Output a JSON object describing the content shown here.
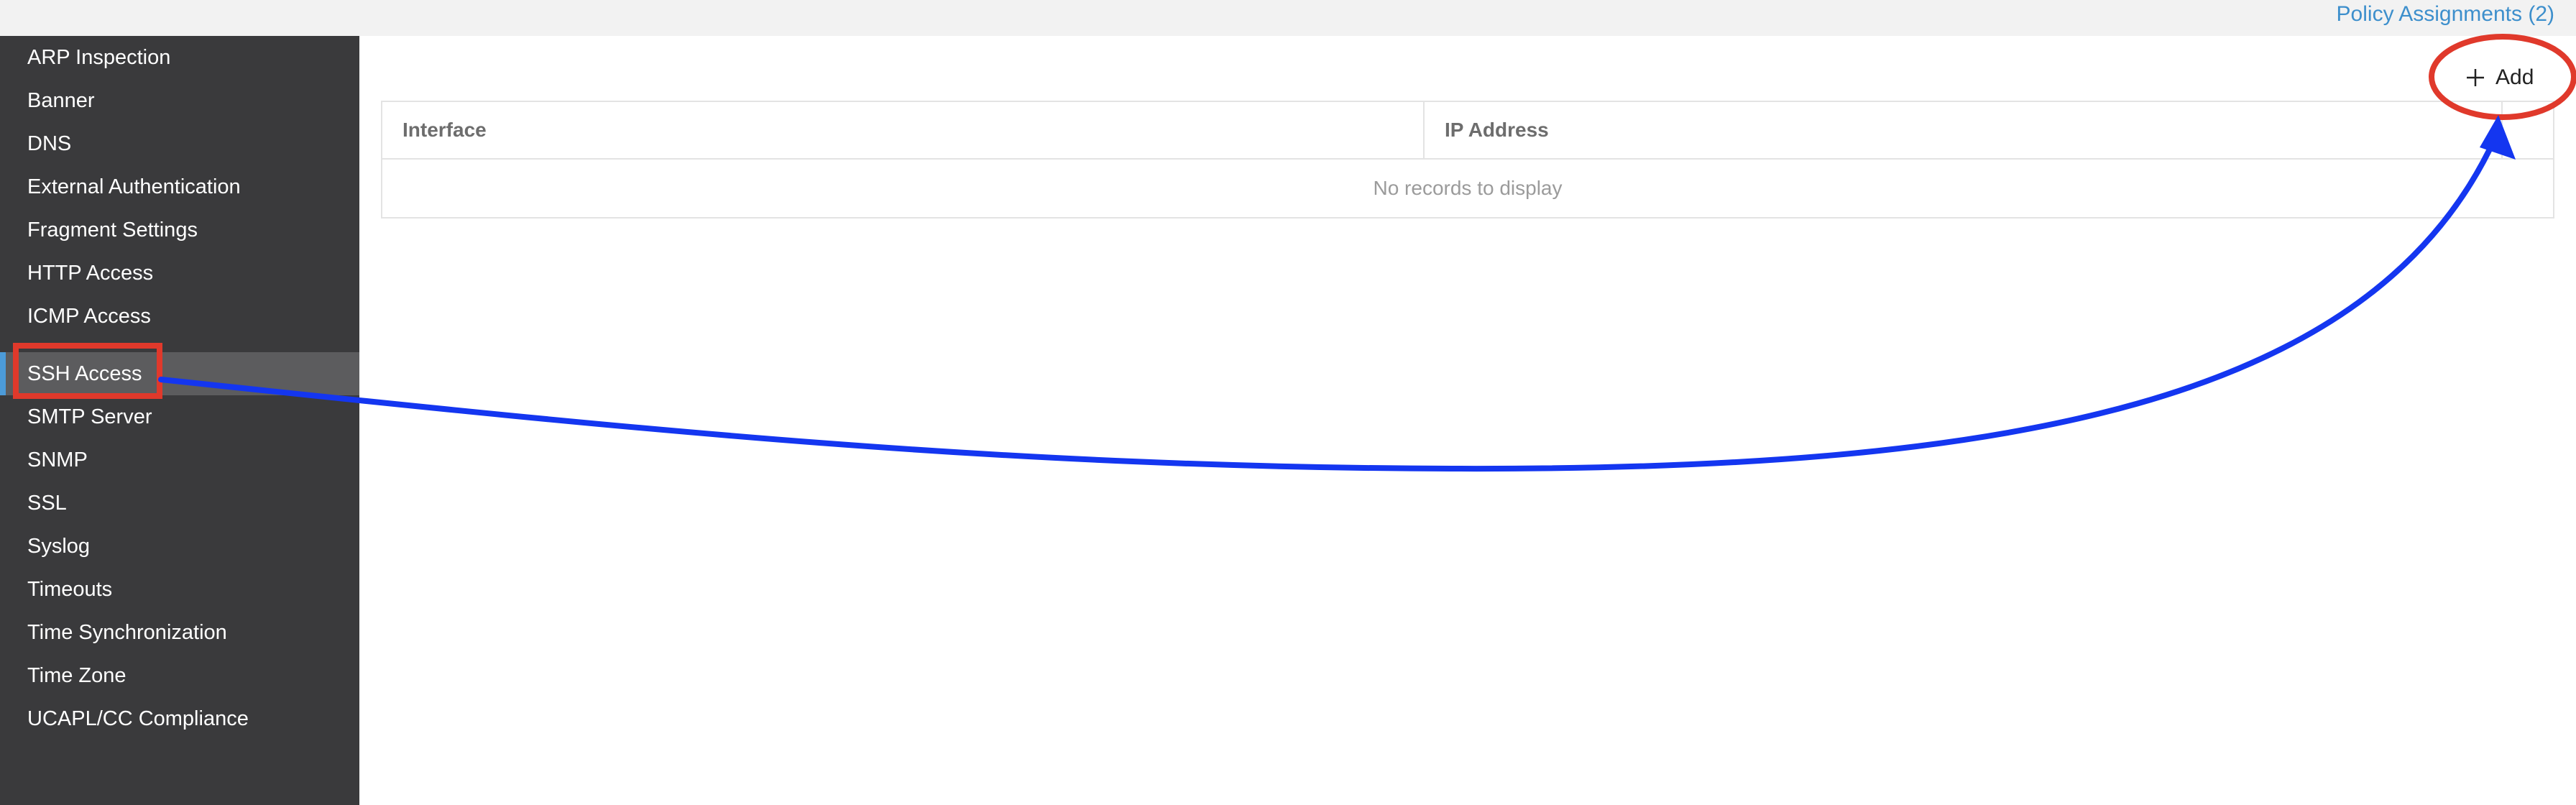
{
  "header": {
    "policy_assignments_link": "Policy Assignments (2)"
  },
  "sidebar": {
    "items": [
      {
        "label": "ARP Inspection",
        "active": false
      },
      {
        "label": "Banner",
        "active": false
      },
      {
        "label": "DNS",
        "active": false
      },
      {
        "label": "External Authentication",
        "active": false
      },
      {
        "label": "Fragment Settings",
        "active": false
      },
      {
        "label": "HTTP Access",
        "active": false
      },
      {
        "label": "ICMP Access",
        "active": false
      },
      {
        "label": "SSH Access",
        "active": true
      },
      {
        "label": "SMTP Server",
        "active": false
      },
      {
        "label": "SNMP",
        "active": false
      },
      {
        "label": "SSL",
        "active": false
      },
      {
        "label": "Syslog",
        "active": false
      },
      {
        "label": "Timeouts",
        "active": false
      },
      {
        "label": "Time Synchronization",
        "active": false
      },
      {
        "label": "Time Zone",
        "active": false
      },
      {
        "label": "UCAPL/CC Compliance",
        "active": false
      }
    ]
  },
  "toolbar": {
    "add_label": "Add",
    "add_icon": "plus-icon"
  },
  "table": {
    "columns": [
      "Interface",
      "IP Address",
      ""
    ],
    "empty_message": "No records to display"
  },
  "annotations": {
    "highlight_color": "#e0392b",
    "arrow_color": "#1436f0"
  },
  "colors": {
    "sidebar_bg": "#3a3a3c",
    "sidebar_active_bg": "#5c5c5e",
    "accent": "#4c9bd9",
    "link": "#3d8fcc"
  }
}
